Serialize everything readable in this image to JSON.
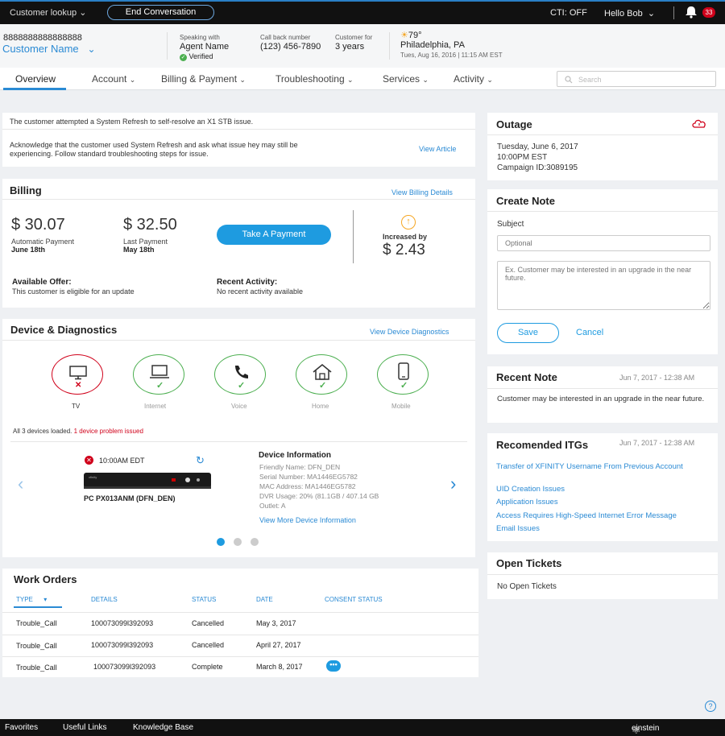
{
  "topbar": {
    "lookup_label": "Customer lookup",
    "end_button": "End Conversation",
    "cti": "CTI: OFF",
    "greeting": "Hello Bob",
    "notification_count": "33"
  },
  "customer": {
    "account_number": "8888888888888888",
    "name": "Customer Name",
    "speaking_with_label": "Speaking with",
    "agent_name": "Agent Name",
    "verified": "Verified",
    "callback_label": "Call back number",
    "callback_number": "(123) 456-7890",
    "customer_for_label": "Customer for",
    "customer_for": "3 years",
    "temperature": "79°",
    "location": "Philadelphia, PA",
    "datetime": "Tues, Aug 16, 2016  |  11:15 AM EST"
  },
  "nav": {
    "tabs": [
      {
        "label": "Overview"
      },
      {
        "label": "Account"
      },
      {
        "label": "Billing & Payment"
      },
      {
        "label": "Troubleshooting"
      },
      {
        "label": "Services"
      },
      {
        "label": "Activity"
      }
    ],
    "search_placeholder": "Search"
  },
  "alert": {
    "headline": "The customer attempted a System Refresh to self-resolve an X1 STB issue.",
    "body": "Acknowledge that the customer used System Refresh and ask what issue hey may still be experiencing. Follow standard troubleshooting steps for issue.",
    "link": "View Article"
  },
  "billing": {
    "title": "Billing",
    "details_link": "View Billing Details",
    "auto_amount": "$ 30.07",
    "auto_label": "Automatic Payment",
    "auto_date": "June 18th",
    "last_amount": "$ 32.50",
    "last_label": "Last Payment",
    "last_date": "May 18th",
    "pay_button": "Take A Payment",
    "increase_label": "Increased by",
    "increase_amount": "$ 2.43",
    "offer_label": "Available Offer:",
    "offer_text": "This customer is eligible for an update",
    "activity_label": "Recent Activity:",
    "activity_text": "No recent activity available"
  },
  "device": {
    "title": "Device & Diagnostics",
    "link": "View Device Diagnostics",
    "items": [
      {
        "label": "TV",
        "status": "error"
      },
      {
        "label": "Internet",
        "status": "ok"
      },
      {
        "label": "Voice",
        "status": "ok"
      },
      {
        "label": "Home",
        "status": "ok"
      },
      {
        "label": "Mobile",
        "status": "ok"
      }
    ],
    "loaded_text": "All 3 devices loaded.",
    "issue_text": "1 device problem issued",
    "time": "10:00AM EDT",
    "device_name": "PC PX013ANM (DFN_DEN)",
    "info_title": "Device Information",
    "friendly_name": "Friendly Name: DFN_DEN",
    "serial": "Serial Number: MA1446EG5782",
    "mac": "MAC Address: MA1446EG5782",
    "dvr": "DVR Usage: 20% (81.1GB / 407.14 GB",
    "outlet": "Outlet: A",
    "more_link": "View More Device Information"
  },
  "work_orders": {
    "title": "Work Orders",
    "columns": [
      "TYPE",
      "DETAILS",
      "STATUS",
      "DATE",
      "CONSENT STATUS"
    ],
    "rows": [
      {
        "type": "Trouble_Call",
        "details": "100073099l392093",
        "status": "Cancelled",
        "date": "May 3, 2017"
      },
      {
        "type": "Trouble_Call",
        "details": "100073099l392093",
        "status": "Cancelled",
        "date": "April 27, 2017"
      },
      {
        "type": "Trouble_Call",
        "details": "100073099l392093",
        "status": "Complete",
        "date": "March 8, 2017"
      }
    ]
  },
  "outage": {
    "title": "Outage",
    "date": "Tuesday, June 6, 2017",
    "time": "10:00PM EST",
    "campaign": "Campaign ID:3089195"
  },
  "create_note": {
    "title": "Create Note",
    "subject_label": "Subject",
    "subject_placeholder": "Optional",
    "body_placeholder": "Ex. Customer may be interested in an upgrade in the near future.",
    "save": "Save",
    "cancel": "Cancel"
  },
  "recent_note": {
    "title": "Recent Note",
    "date": "Jun 7, 2017 - 12:38 AM",
    "text": "Customer may be interested in an upgrade in the near future."
  },
  "itgs": {
    "title": "Recomended ITGs",
    "date": "Jun 7, 2017 - 12:38 AM",
    "links": [
      "Transfer of XFINITY Username From Previous Account",
      "UID Creation Issues",
      "Application Issues",
      "Access Requires High-Speed Internet Error Message",
      "Email Issues"
    ]
  },
  "tickets": {
    "title": "Open Tickets",
    "text": "No Open Tickets"
  },
  "footer": {
    "favorites": "Favorites",
    "useful_links": "Useful Links",
    "knowledge_base": "Knowledge Base",
    "brand": "einstein"
  },
  "colors": {
    "accent": "#2a8ad4",
    "ok": "#4caf50",
    "error": "#d0021b"
  }
}
